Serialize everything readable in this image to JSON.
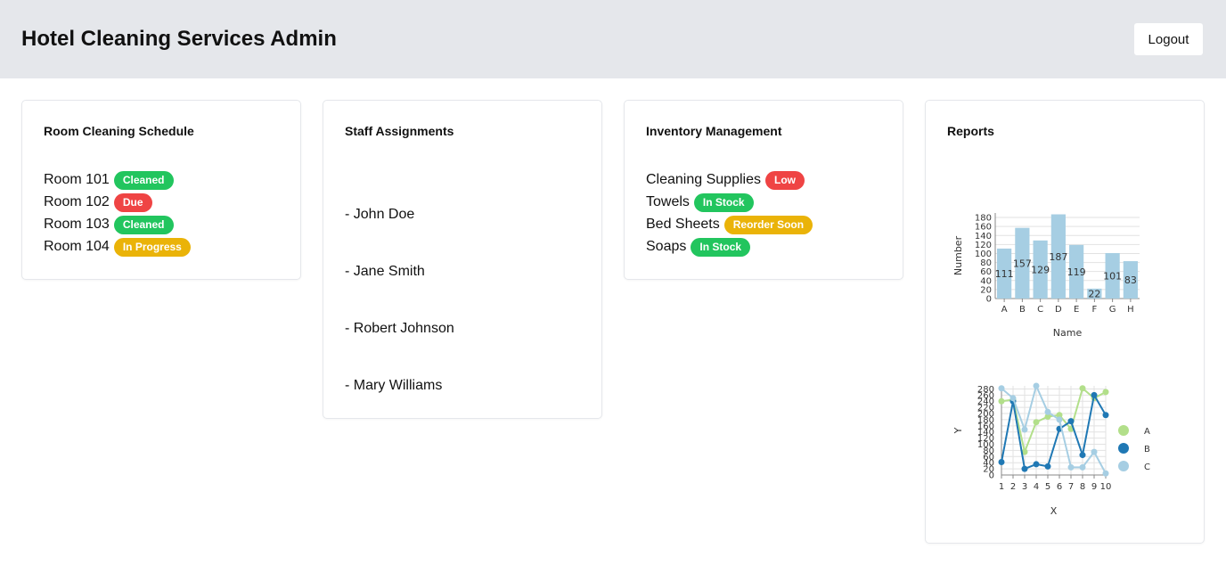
{
  "header": {
    "title": "Hotel Cleaning Services Admin",
    "logout_label": "Logout"
  },
  "schedule": {
    "title": "Room Cleaning Schedule",
    "rooms": [
      {
        "name": "Room 101",
        "status": "Cleaned",
        "color": "#22c55e"
      },
      {
        "name": "Room 102",
        "status": "Due",
        "color": "#ef4444"
      },
      {
        "name": "Room 103",
        "status": "Cleaned",
        "color": "#22c55e"
      },
      {
        "name": "Room 104",
        "status": "In Progress",
        "color": "#eab308"
      }
    ]
  },
  "staff": {
    "title": "Staff Assignments",
    "members": [
      "- John Doe",
      "- Jane Smith",
      "- Robert Johnson",
      "- Mary Williams"
    ]
  },
  "inventory": {
    "title": "Inventory Management",
    "items": [
      {
        "name": "Cleaning Supplies",
        "status": "Low",
        "color": "#ef4444"
      },
      {
        "name": "Towels",
        "status": "In Stock",
        "color": "#22c55e"
      },
      {
        "name": "Bed Sheets",
        "status": "Reorder Soon",
        "color": "#eab308"
      },
      {
        "name": "Soaps",
        "status": "In Stock",
        "color": "#22c55e"
      }
    ]
  },
  "reports": {
    "title": "Reports"
  },
  "chart_data": [
    {
      "type": "bar",
      "categories": [
        "A",
        "B",
        "C",
        "D",
        "E",
        "F",
        "G",
        "H"
      ],
      "values": [
        111,
        157,
        129,
        187,
        119,
        22,
        101,
        83
      ],
      "xlabel": "Name",
      "ylabel": "Number",
      "ylim": [
        0,
        190
      ],
      "yticks": [
        0,
        20,
        40,
        60,
        80,
        100,
        120,
        140,
        160,
        180
      ],
      "color": "#a6cee3",
      "grid": true
    },
    {
      "type": "line",
      "x": [
        1,
        2,
        3,
        4,
        5,
        6,
        7,
        8,
        9,
        10
      ],
      "xlabel": "X",
      "ylabel": "Y",
      "ylim": [
        0,
        290
      ],
      "yticks": [
        0,
        20,
        40,
        60,
        80,
        100,
        120,
        140,
        160,
        180,
        200,
        220,
        240,
        260,
        280
      ],
      "legend_position": "right",
      "grid": true,
      "series": [
        {
          "name": "A",
          "color": "#b2df8a",
          "values": [
            240,
            245,
            75,
            172,
            190,
            195,
            150,
            282,
            250,
            270
          ]
        },
        {
          "name": "B",
          "color": "#1f78b4",
          "values": [
            42,
            240,
            20,
            35,
            28,
            150,
            175,
            65,
            260,
            195
          ]
        },
        {
          "name": "C",
          "color": "#a6cee3",
          "values": [
            282,
            250,
            148,
            290,
            205,
            180,
            25,
            25,
            75,
            5
          ]
        }
      ]
    }
  ]
}
